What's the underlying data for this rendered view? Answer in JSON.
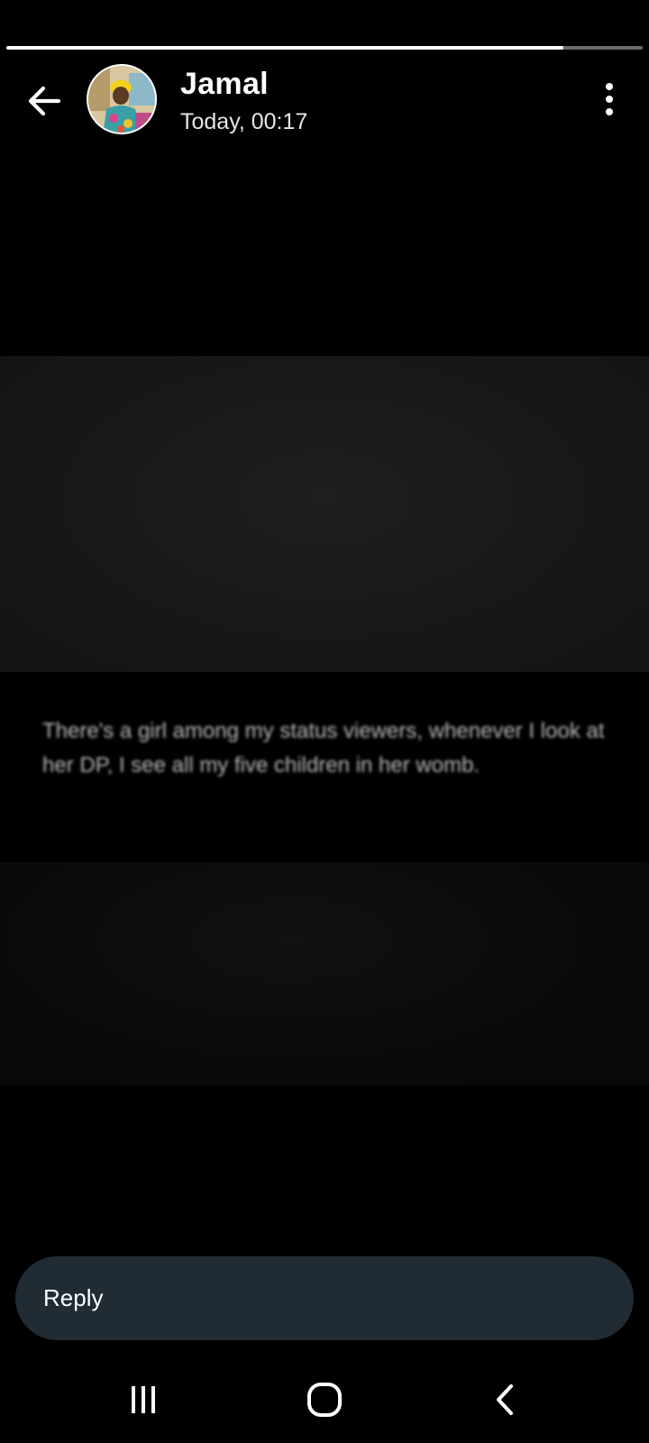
{
  "status_header": {
    "contact_name": "Jamal",
    "timestamp": "Today, 00:17",
    "progress_fraction": 0.875
  },
  "status_post": {
    "text": "There's a girl among my status viewers, whenever I look at her DP, I see all my five children in her womb."
  },
  "reply": {
    "label": "Reply"
  },
  "icons": {
    "back": "arrow-left-icon",
    "more": "more-vertical-icon",
    "nav_recents": "recents-icon",
    "nav_home": "home-icon",
    "nav_back": "chevron-left-icon"
  },
  "colors": {
    "background": "#000000",
    "reply_bar": "#202b33",
    "progress_active": "#ffffff",
    "progress_track": "#6b6b6b"
  }
}
